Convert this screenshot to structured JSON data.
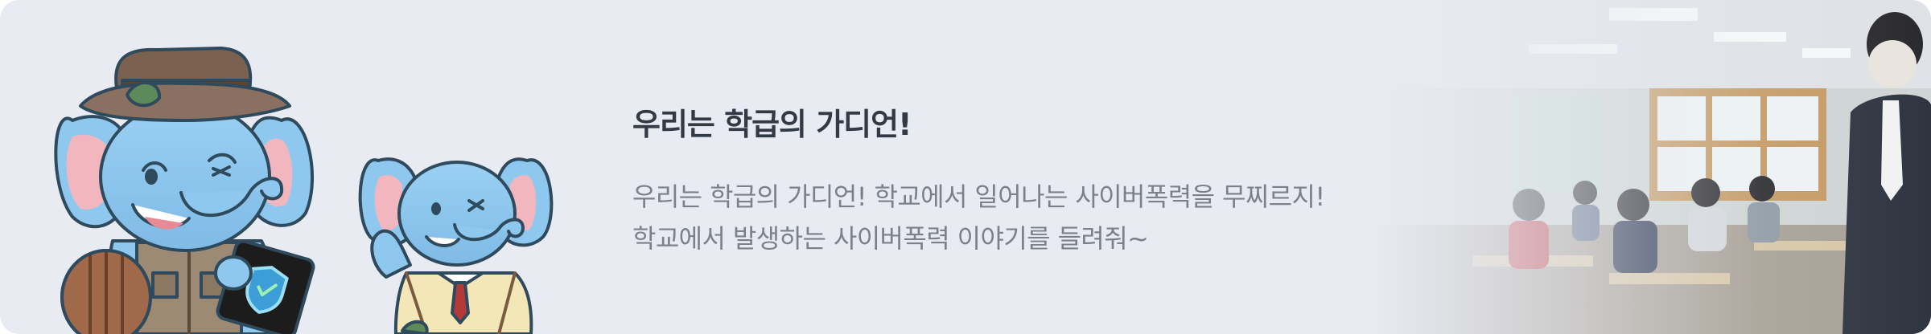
{
  "banner": {
    "title": "우리는 학급의 가디언!",
    "description_line1": "우리는 학급의 가디언! 학교에서 일어나는 사이버폭력을 무찌르지!",
    "description_line2": "학교에서 발생하는 사이버폭력 이야기를 들려줘~",
    "background_color": "#e8ebf2",
    "mascot_color": "#8ec8ef",
    "mascot_outline": "#2f4a5c"
  }
}
